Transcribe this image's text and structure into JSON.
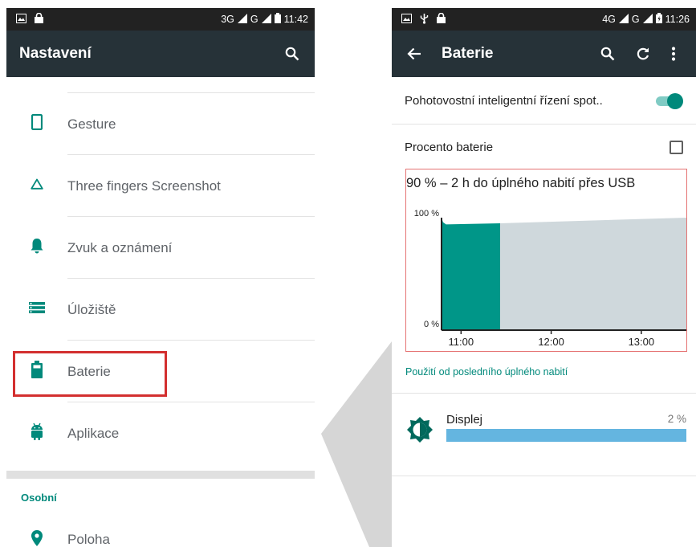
{
  "left_screen": {
    "status": {
      "network": "3G",
      "network2": "G",
      "time": "11:42"
    },
    "title": "Nastavení",
    "items": [
      {
        "label": "Gesture",
        "icon": "phone-icon"
      },
      {
        "label": "Three fingers Screenshot",
        "icon": "triangle-icon"
      },
      {
        "label": "Zvuk a oznámení",
        "icon": "bell-icon"
      },
      {
        "label": "Úložiště",
        "icon": "storage-icon"
      },
      {
        "label": "Baterie",
        "icon": "battery-icon",
        "highlighted": true
      },
      {
        "label": "Aplikace",
        "icon": "android-icon"
      }
    ],
    "section_header": "Osobní",
    "section_items": [
      {
        "label": "Poloha",
        "icon": "location-icon"
      }
    ]
  },
  "right_screen": {
    "status": {
      "network": "4G",
      "network2": "G",
      "time": "11:26"
    },
    "title": "Baterie",
    "pref_smart": "Pohotovostní inteligentní řízení spot..",
    "pref_smart_on": true,
    "pref_percent": "Procento baterie",
    "pref_percent_checked": false,
    "usage_link": "Použití od posledního úplného nabití",
    "app_usage": [
      {
        "name": "Displej",
        "percent_label": "2 %",
        "fraction": 1.0
      }
    ]
  },
  "chart_data": {
    "type": "area",
    "title": "90 % – 2 h do úplného nabití přes USB",
    "y_ticks": [
      "100 %",
      "0 %"
    ],
    "x_ticks": [
      "11:00",
      "12:00",
      "13:00"
    ],
    "ylim": [
      0,
      100
    ],
    "xlim": [
      "10:47",
      "13:30"
    ],
    "series": [
      {
        "name": "",
        "color": "#009688",
        "points": [
          [
            "10:47",
            100
          ],
          [
            "10:48",
            96
          ],
          [
            "10:50",
            94
          ],
          [
            "11:26",
            95
          ]
        ]
      },
      {
        "name": "",
        "color": "#cfd8dc",
        "points": [
          [
            "11:26",
            95
          ],
          [
            "13:30",
            100
          ]
        ]
      }
    ]
  },
  "colors": {
    "appbar": "#263238",
    "statusbar": "#222222",
    "accent": "#00897b",
    "chart_history": "#009688",
    "chart_projection": "#cfd8dc",
    "highlight": "#d32f2f",
    "usage_bar": "#64b5e0"
  }
}
